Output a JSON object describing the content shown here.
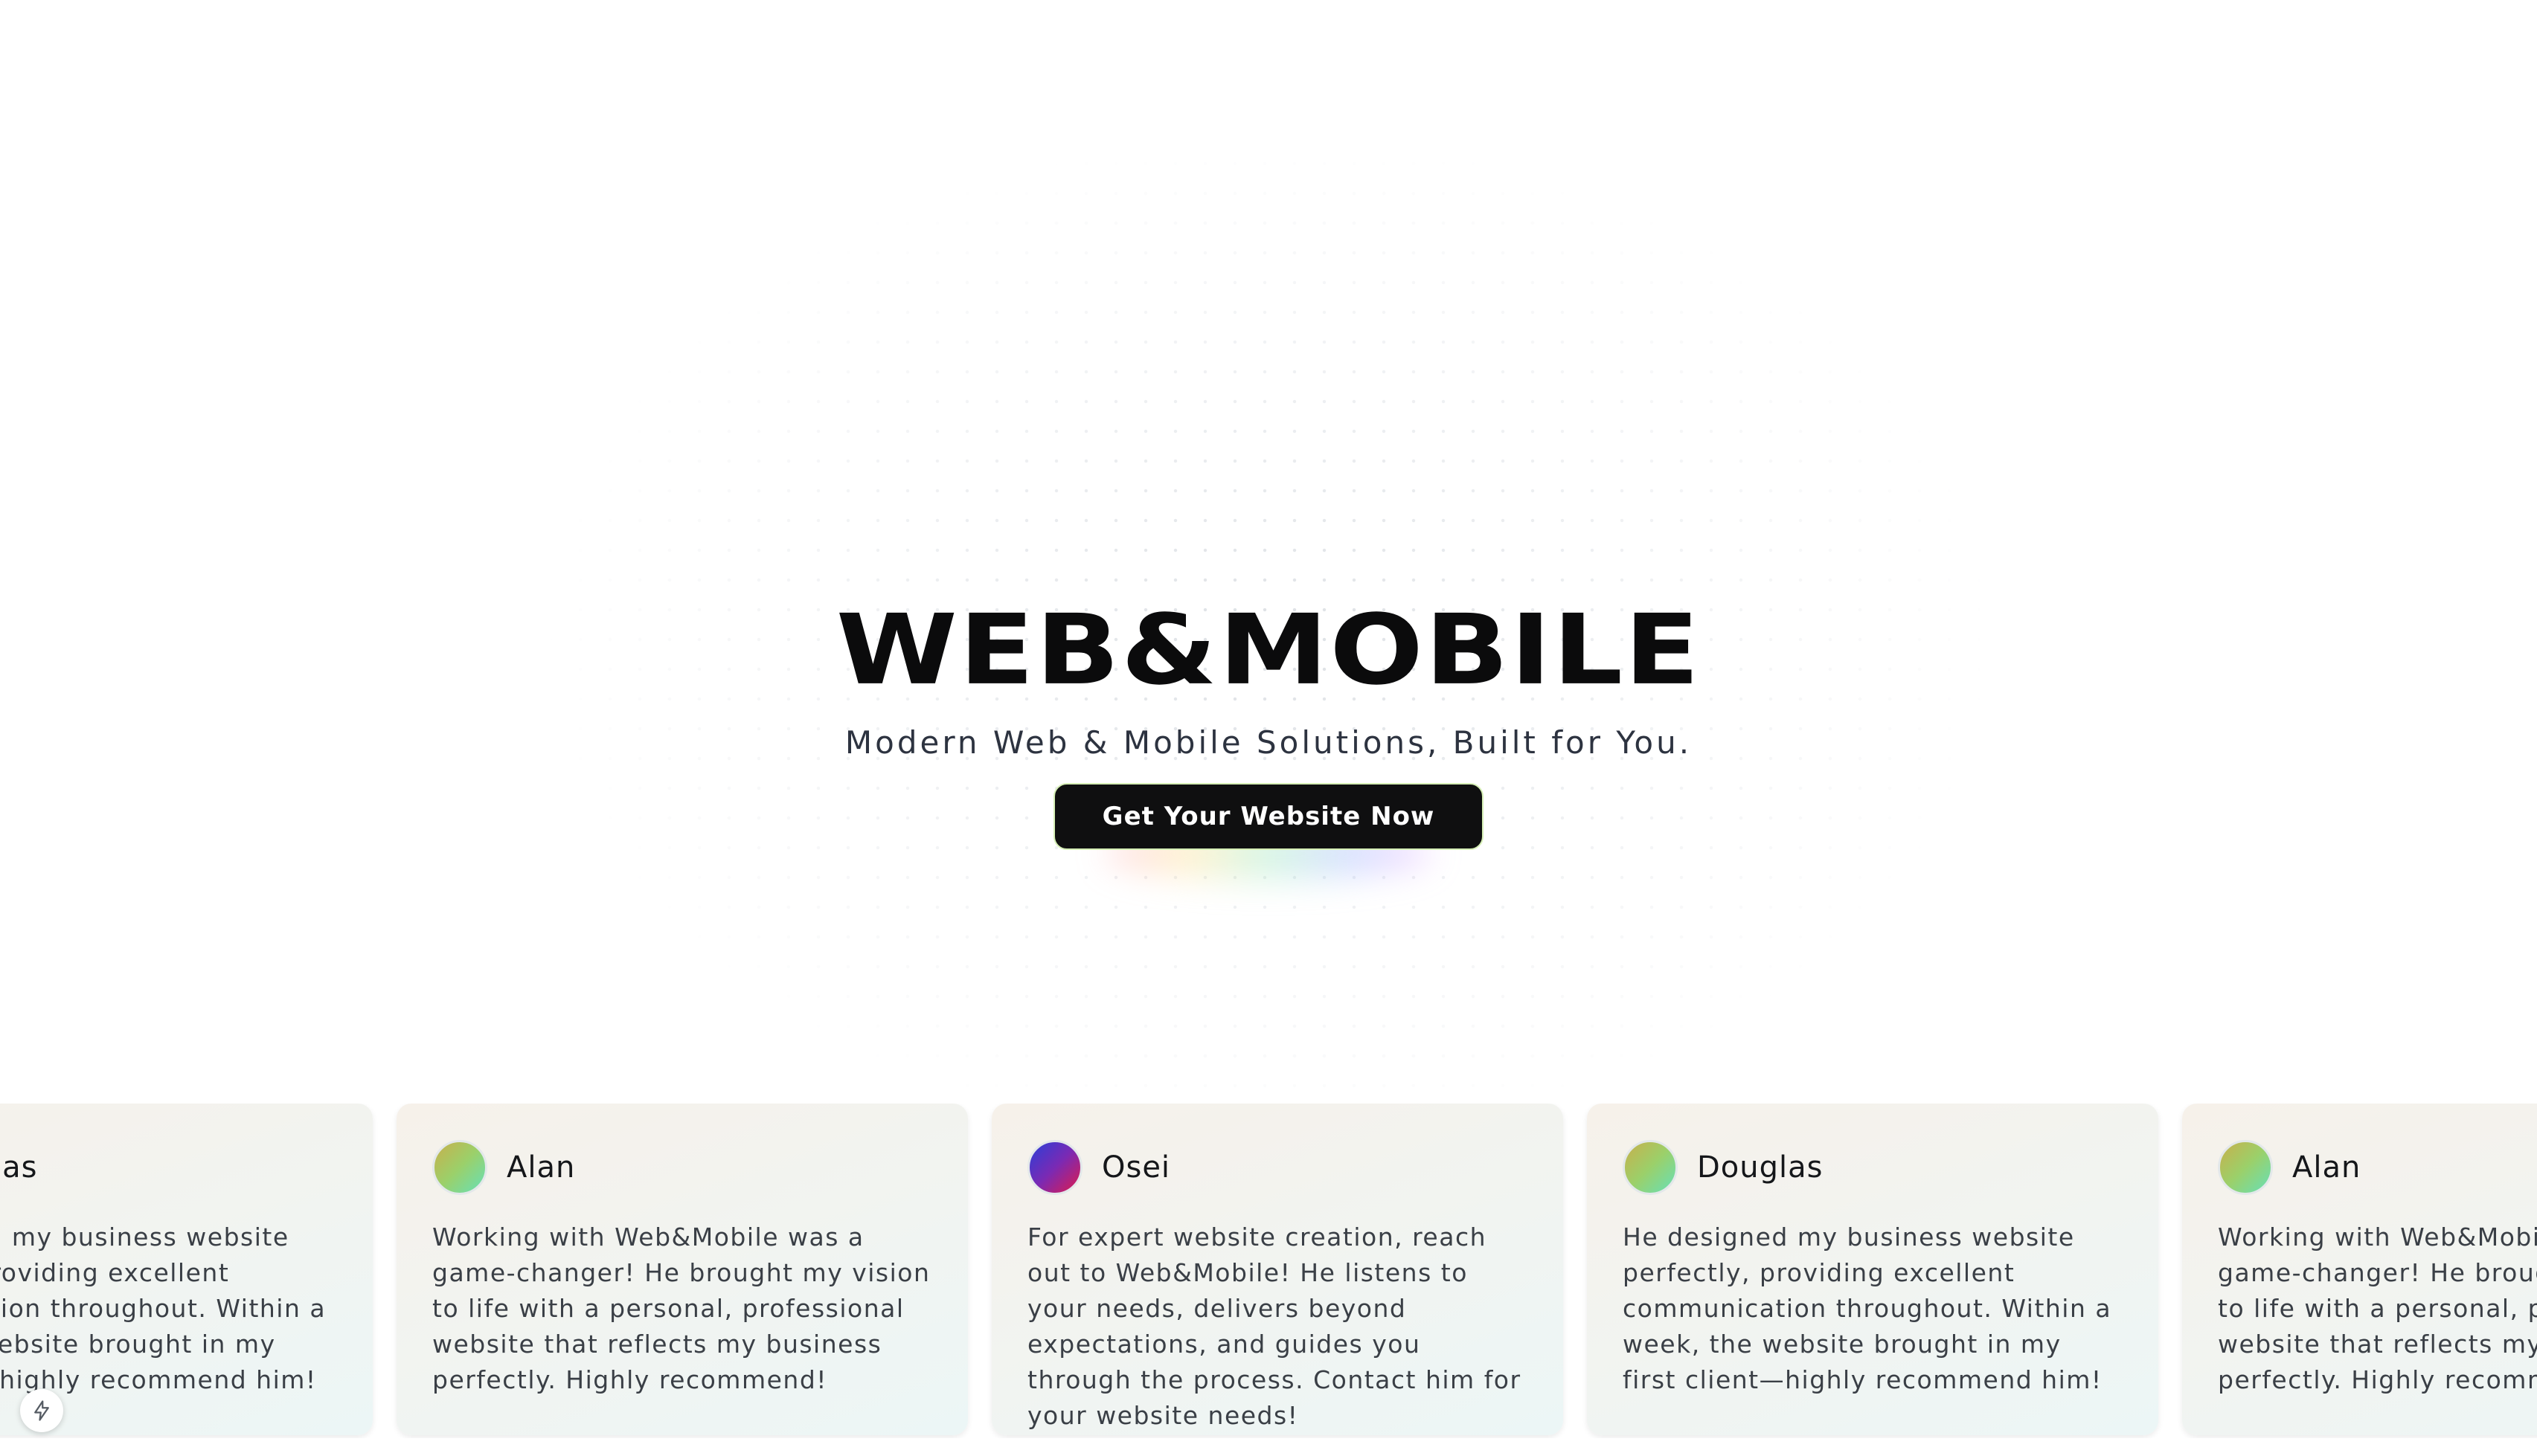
{
  "hero": {
    "brand": "WEB&MOBILE",
    "tagline": "Modern Web & Mobile Solutions, Built for You.",
    "cta_label": "Get Your Website Now"
  },
  "testimonials": [
    {
      "name": "Douglas",
      "avatar": "green-gradient",
      "quote": "He designed my business website perfectly, providing excellent communication throughout. Within a week, the website brought in my first client—highly recommend him!"
    },
    {
      "name": "Alan",
      "avatar": "green-gradient",
      "quote": "Working with Web&Mobile was a game-changer! He brought my vision to life with a personal, professional website that reflects my business perfectly. Highly recommend!"
    },
    {
      "name": "Osei",
      "avatar": "purple-gradient",
      "quote": "For expert website creation, reach out to Web&Mobile! He listens to your needs, delivers beyond expectations, and guides you through the process. Contact him for your website needs!"
    },
    {
      "name": "Douglas",
      "avatar": "green-gradient",
      "quote": "He designed my business website perfectly, providing excellent communication throughout. Within a week, the website brought in my first client—highly recommend him!"
    },
    {
      "name": "Alan",
      "avatar": "green-gradient",
      "quote": "Working with Web&Mobile was a game-changer! He brought my vision to life with a personal, professional website that reflects my business perfectly. Highly recommend!"
    }
  ],
  "floating_button": {
    "icon": "lightning-icon"
  },
  "colors": {
    "background": "#ffffff",
    "brand_text": "#0b0b0c",
    "cta_background": "#0f0f10",
    "cta_text": "#ffffff",
    "card_background": "#f3f3ef"
  }
}
